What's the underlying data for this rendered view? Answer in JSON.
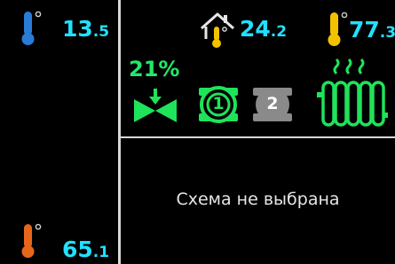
{
  "outdoor_temp": {
    "int": "13",
    "frac": ".5",
    "icon": "thermometer-blue-icon",
    "color": "#2a7bd6"
  },
  "boiler_temp": {
    "int": "65",
    "frac": ".1",
    "icon": "thermometer-orange-icon",
    "color": "#e8661c"
  },
  "indoor_temp": {
    "int": "24",
    "frac": ".2",
    "icon": "house-thermometer-icon"
  },
  "supply_temp": {
    "int": "77",
    "frac": ".3",
    "icon": "thermometer-yellow-icon",
    "color": "#f2c200"
  },
  "valve": {
    "percent": "21%",
    "icon": "mixing-valve-icon",
    "color": "#1fe35a"
  },
  "pumps": [
    {
      "label": "1",
      "state": "on",
      "color": "#1fe35a"
    },
    {
      "label": "2",
      "state": "off",
      "color": "#8a8a8a"
    }
  ],
  "radiator": {
    "icon": "radiator-heating-icon",
    "color": "#1fe35a"
  },
  "scheme_message": "Схема не выбрана",
  "value_color": "#22e0ff"
}
